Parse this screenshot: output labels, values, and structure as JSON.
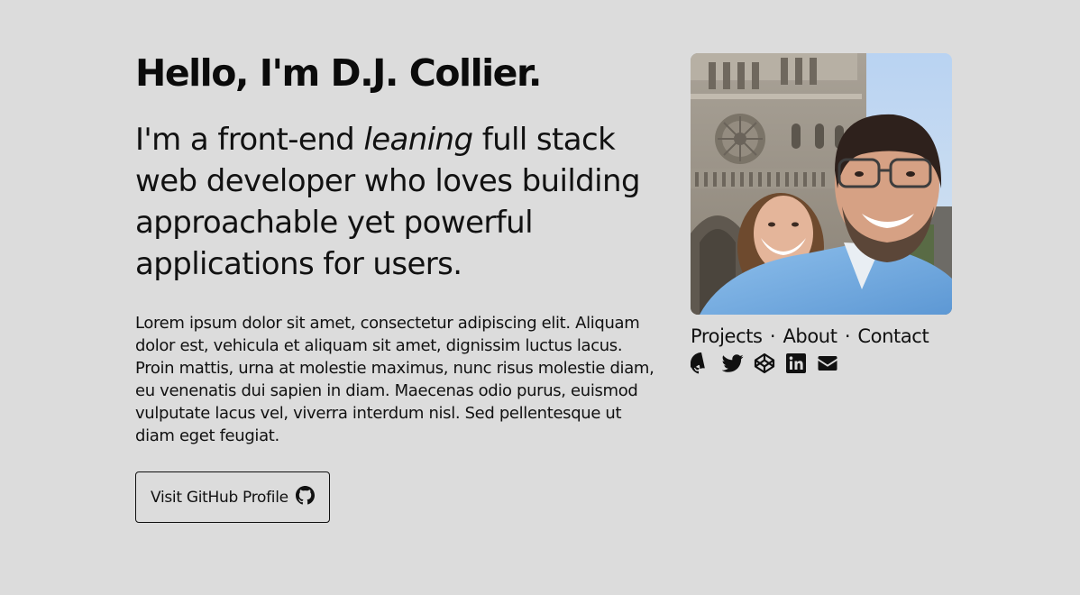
{
  "hero": {
    "title": "Hello, I'm D.J. Collier.",
    "tagline_before": "I'm a front-end ",
    "tagline_emphasis": "leaning",
    "tagline_after": " full stack web developer who loves building approachable yet powerful applications for users.",
    "body": "Lorem ipsum dolor sit amet, consectetur adipiscing elit. Aliquam dolor est, vehicula et aliquam sit amet, dignissim luctus lacus. Proin mattis, urna at molestie maximus, nunc risus molestie diam, eu venenatis dui sapien in diam. Maecenas odio purus, euismod vulputate lacus vel, viverra interdum nisl. Sed pellentesque ut diam eget feugiat.",
    "button_label": "Visit GitHub Profile",
    "button_icon": "github-icon"
  },
  "nav": {
    "projects": "Projects",
    "about": "About",
    "contact": "Contact",
    "separator": "·"
  },
  "socials": [
    "github-icon",
    "twitter-icon",
    "codepen-icon",
    "linkedin-icon",
    "envelope-icon"
  ],
  "colors": {
    "background": "#dcdcdc",
    "text": "#111111"
  }
}
